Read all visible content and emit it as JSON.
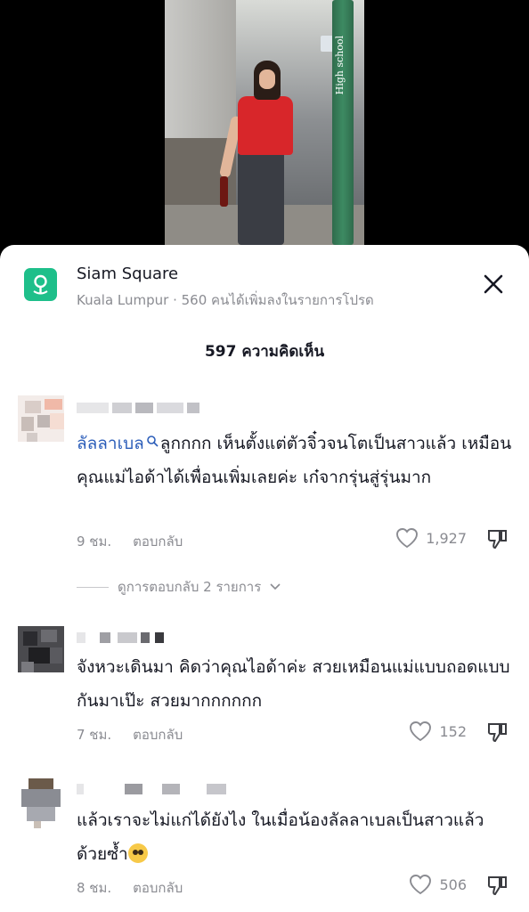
{
  "location": {
    "title": "Siam Square",
    "subtitle": "Kuala Lumpur · 560 คนได้เพิ่มลงในรายการโปรด"
  },
  "comments_count": "597 ความคิดเห็น",
  "video": {
    "pole_text": "High school"
  },
  "comments": [
    {
      "mention": "ลัลลาเบล",
      "text": "ลูกกกก เห็นตั้งแต่ตัวจิ๋วจนโตเป็นสาวแล้ว เหมือนคุณแม่ไอด้าได้เพื่อนเพิ่มเลยค่ะ เก๋จากรุ่นสู่รุ่นมาก",
      "time": "9 ชม.",
      "reply_label": "ตอบกลับ",
      "likes": "1,927",
      "view_replies": "ดูการตอบกลับ 2 รายการ"
    },
    {
      "text": "จังหวะเดินมา คิดว่าคุณไอด้าค่ะ สวยเหมือนแม่แบบถอดแบบกันมาเป๊ะ สวยมากกกกกก",
      "time": "7 ชม.",
      "reply_label": "ตอบกลับ",
      "likes": "152"
    },
    {
      "text": "แล้วเราจะไม่แก่ได้ยังไง ในเมื่อน้องลัลลาเบลเป็นสาวแล้วด้วยซ้ำ",
      "time": "8 ชม.",
      "reply_label": "ตอบกลับ",
      "likes": "506"
    }
  ],
  "colors": {
    "brand_green": "#1ebf8a",
    "mention_blue": "#2b5db9",
    "muted": "#8a8b91"
  }
}
